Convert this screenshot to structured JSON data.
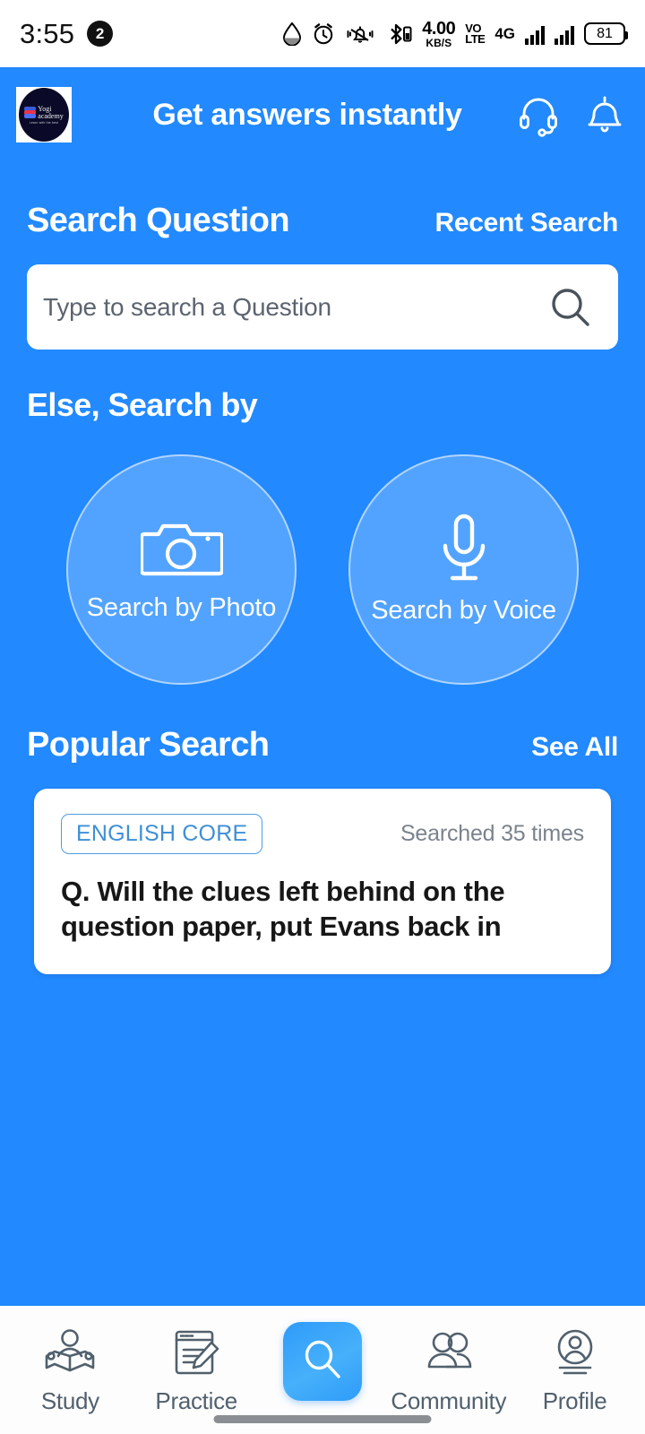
{
  "status_bar": {
    "time": "3:55",
    "notification_count": "2",
    "data_rate_value": "4.00",
    "data_rate_unit": "KB/S",
    "volte_line1": "VO",
    "volte_line2": "LTE",
    "network_type": "4G",
    "battery_level": "81",
    "icons": [
      "water-drop-icon",
      "alarm-clock-icon",
      "mute-bell-icon",
      "bluetooth-icon",
      "data-rate-icon",
      "volte-icon",
      "signal-bars-icon",
      "signal-bars-icon",
      "battery-icon"
    ]
  },
  "header": {
    "logo_name": "Yogi",
    "logo_name2": "academy",
    "logo_tagline": "Learn with the best",
    "title": "Get answers instantly",
    "support_icon": "headset-icon",
    "notification_icon": "bell-icon"
  },
  "search_section": {
    "title": "Search Question",
    "recent_link": "Recent Search",
    "input_placeholder": "Type to search a Question",
    "input_value": "",
    "search_icon": "search-icon"
  },
  "else_search": {
    "title": "Else, Search by",
    "options": [
      {
        "label": "Search by Photo",
        "icon": "camera-icon"
      },
      {
        "label": "Search by Voice",
        "icon": "microphone-icon"
      }
    ]
  },
  "popular_search": {
    "title": "Popular Search",
    "see_all": "See All",
    "cards": [
      {
        "subject": "ENGLISH CORE",
        "searched": "Searched 35 times",
        "question": "Q. Will the clues left behind on the question paper, put Evans back in"
      }
    ]
  },
  "bottom_nav": {
    "items": [
      {
        "label": "Study",
        "icon": "reading-person-icon",
        "active": false
      },
      {
        "label": "Practice",
        "icon": "notepad-pencil-icon",
        "active": false
      },
      {
        "label": "",
        "icon": "search-icon",
        "active": true
      },
      {
        "label": "Community",
        "icon": "people-icon",
        "active": false
      },
      {
        "label": "Profile",
        "icon": "user-circle-icon",
        "active": false
      }
    ]
  },
  "colors": {
    "brand_blue": "#2289ff",
    "circle_fill": "#4a94ce",
    "chip_blue": "#3f8fd6",
    "fab_blue": "#3aa2fa",
    "nav_icon": "#51606d"
  }
}
